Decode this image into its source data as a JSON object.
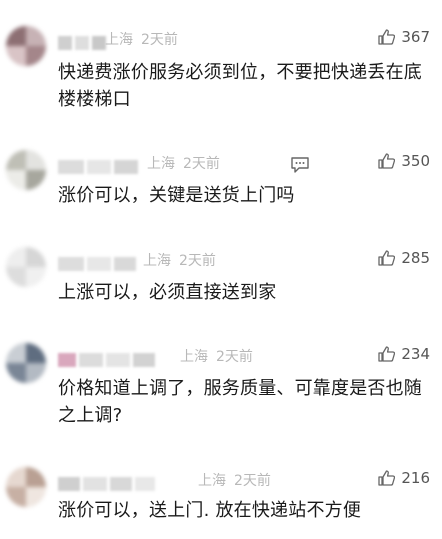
{
  "comments": [
    {
      "location": "上海",
      "time": "2天前",
      "likes": "367",
      "text": "快递费涨价服务必须到位，不要把快递丢在底楼楼梯口",
      "has_reply_icon": false
    },
    {
      "location": "上海",
      "time": "2天前",
      "likes": "350",
      "text": "涨价可以，关键是送货上门吗",
      "has_reply_icon": true
    },
    {
      "location": "上海",
      "time": "2天前",
      "likes": "285",
      "text": "上涨可以，必须直接送到家",
      "has_reply_icon": false
    },
    {
      "location": "上海",
      "time": "2天前",
      "likes": "234",
      "text": "价格知道上调了，服务质量、可靠度是否也随之上调?",
      "has_reply_icon": false
    },
    {
      "location": "上海",
      "time": "2天前",
      "likes": "216",
      "text": "涨价可以，送上门. 放在快递站不方便",
      "has_reply_icon": false
    }
  ],
  "icons": {
    "like": "thumbs-up-icon",
    "reply": "comment-bubble-icon"
  },
  "colors": {
    "meta": "#b8b8b8",
    "text": "#1a1a1a",
    "likes": "#555555"
  }
}
